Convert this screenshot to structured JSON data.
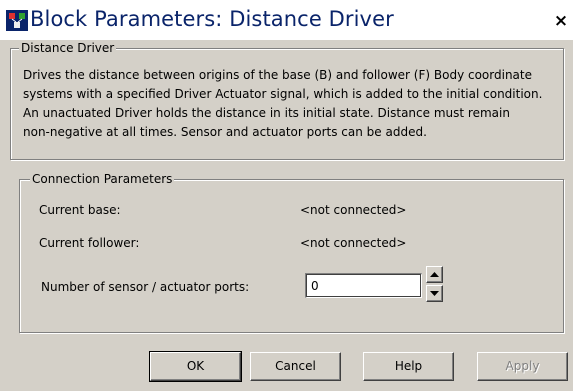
{
  "window": {
    "title": "Block Parameters: Distance Driver",
    "close_glyph": "×",
    "icon": "simulink-block-icon"
  },
  "description_group": {
    "legend": "Distance Driver",
    "lines": [
      "Drives the distance between origins of the base (B) and follower (F) Body coordinate",
      "systems with a specified Driver Actuator signal, which is added to the initial condition.",
      "An unactuated Driver holds the distance in its initial state. Distance must remain",
      "non-negative at all times. Sensor and actuator ports can be added."
    ]
  },
  "connection_group": {
    "legend": "Connection Parameters",
    "current_base_label": "Current base:",
    "current_base_value": "<not connected>",
    "current_follower_label": "Current follower:",
    "current_follower_value": "<not connected>",
    "ports_label": "Number of sensor / actuator ports:",
    "ports_value": "0",
    "spin_up_icon": "spin-up-arrow-icon",
    "spin_down_icon": "spin-down-arrow-icon"
  },
  "buttons": {
    "ok": "OK",
    "cancel": "Cancel",
    "help": "Help",
    "apply": "Apply"
  }
}
